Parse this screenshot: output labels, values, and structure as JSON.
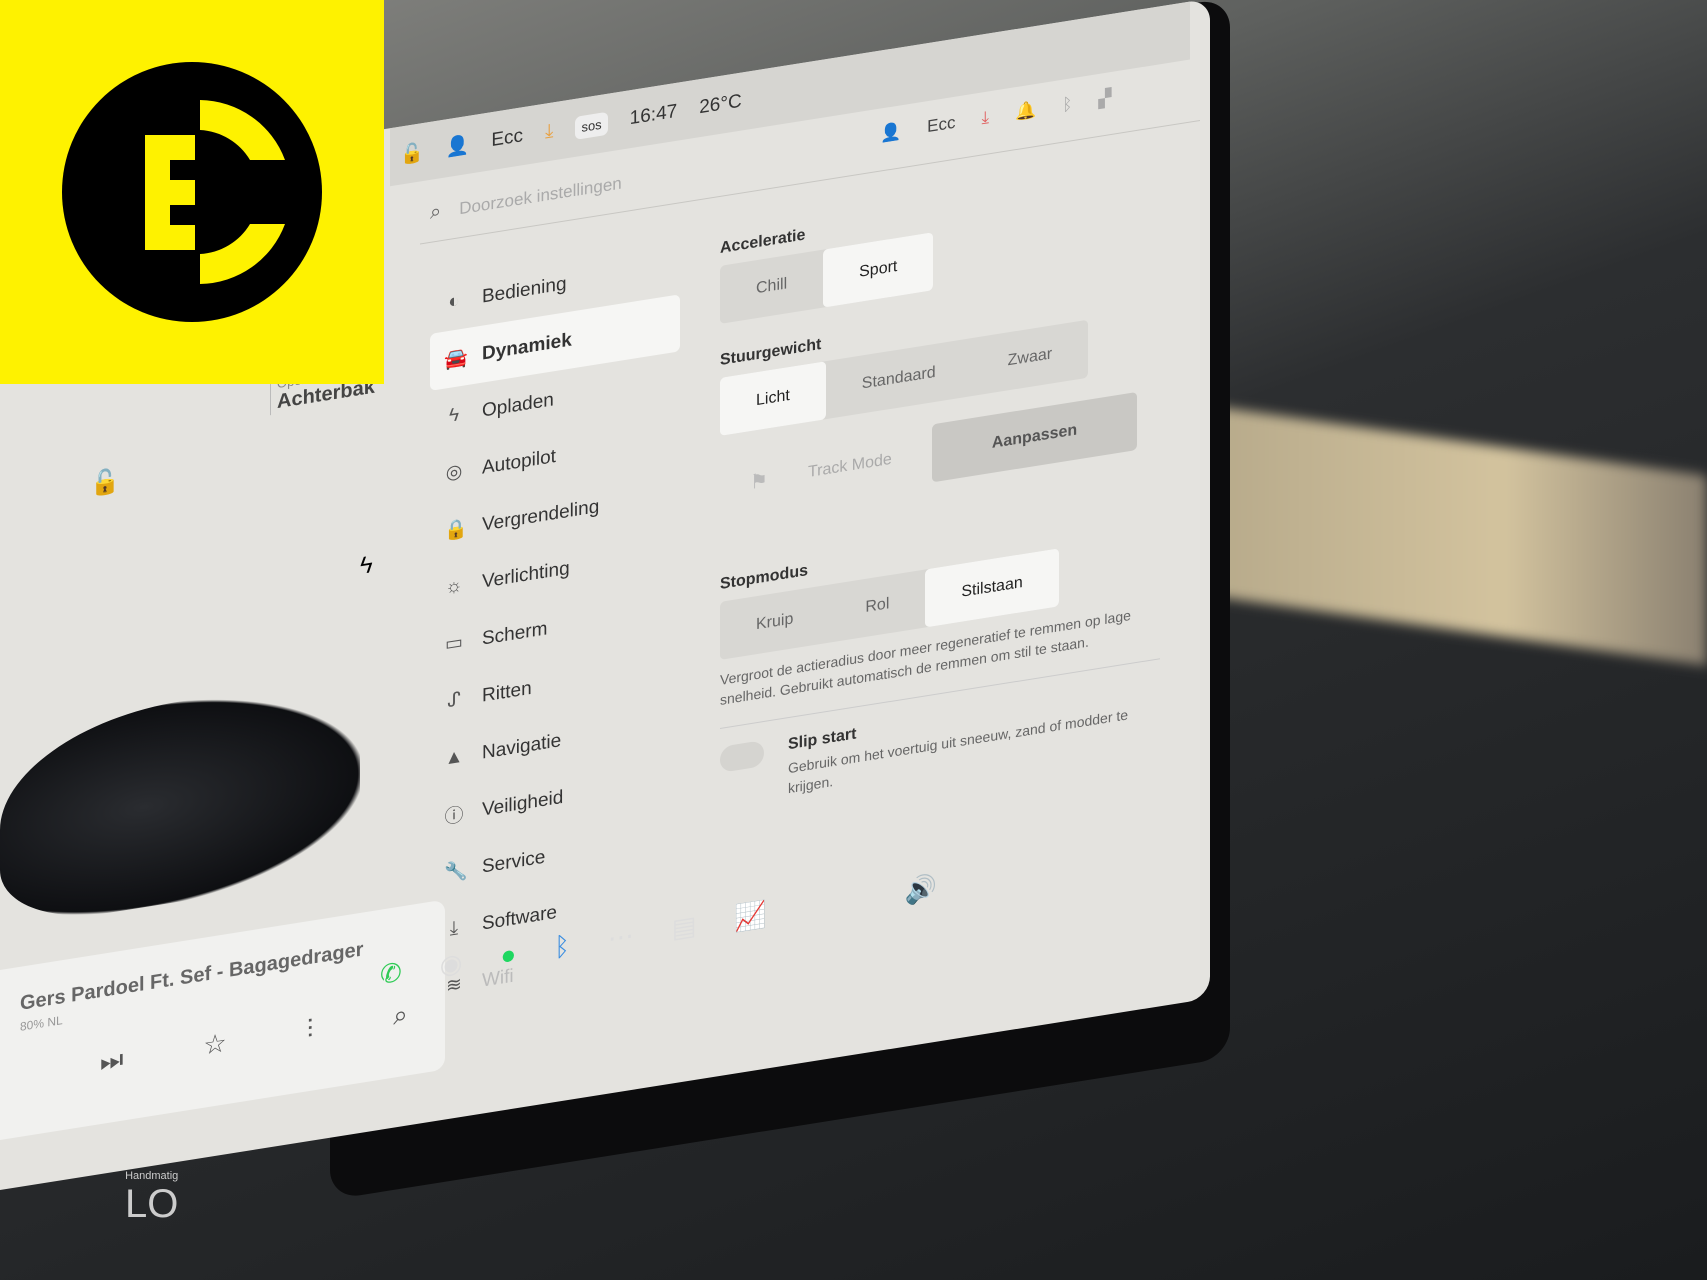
{
  "logo": {
    "text": "EC",
    "bg": "#fef200"
  },
  "status_bar": {
    "user": "Ecc",
    "sos": "sos",
    "time": "16:47",
    "temperature": "26°C"
  },
  "header": {
    "search_placeholder": "Doorzoek instellingen",
    "user": "Ecc"
  },
  "sidebar": {
    "items": [
      {
        "label": "Bediening",
        "icon": "toggle-icon"
      },
      {
        "label": "Dynamiek",
        "icon": "car-icon",
        "active": true
      },
      {
        "label": "Opladen",
        "icon": "bolt-icon"
      },
      {
        "label": "Autopilot",
        "icon": "steering-wheel-icon"
      },
      {
        "label": "Vergrendeling",
        "icon": "lock-icon"
      },
      {
        "label": "Verlichting",
        "icon": "light-icon"
      },
      {
        "label": "Scherm",
        "icon": "display-icon"
      },
      {
        "label": "Ritten",
        "icon": "trips-icon"
      },
      {
        "label": "Navigatie",
        "icon": "navigation-icon"
      },
      {
        "label": "Veiligheid",
        "icon": "info-icon"
      },
      {
        "label": "Service",
        "icon": "wrench-icon"
      },
      {
        "label": "Software",
        "icon": "download-icon"
      },
      {
        "label": "Wifi",
        "icon": "wifi-icon"
      }
    ]
  },
  "settings": {
    "acceleration": {
      "label": "Acceleratie",
      "options": [
        "Chill",
        "Sport"
      ],
      "selected": "Sport"
    },
    "steering": {
      "label": "Stuurgewicht",
      "options": [
        "Licht",
        "Standaard",
        "Zwaar"
      ],
      "selected": "Licht"
    },
    "track_mode": {
      "label": "Track Mode",
      "button": "Aanpassen"
    },
    "stop_mode": {
      "label": "Stopmodus",
      "options": [
        "Kruip",
        "Rol",
        "Stilstaan"
      ],
      "selected": "Stilstaan",
      "description": "Vergroot de actieradius door meer regeneratief te remmen op lage snelheid. Gebruikt automatisch de remmen om stil te staan."
    },
    "slip_start": {
      "label": "Slip start",
      "description": "Gebruik om het voertuig uit sneeuw, zand of modder te krijgen.",
      "enabled": false
    }
  },
  "car_panel": {
    "trunk_status": "Open",
    "trunk_label": "Achterbak"
  },
  "media": {
    "title": "Gers Pardoel Ft. Sef - Bagagedrager",
    "source": "80% NL"
  },
  "climate": {
    "label": "Handmatig",
    "value": "LO"
  }
}
